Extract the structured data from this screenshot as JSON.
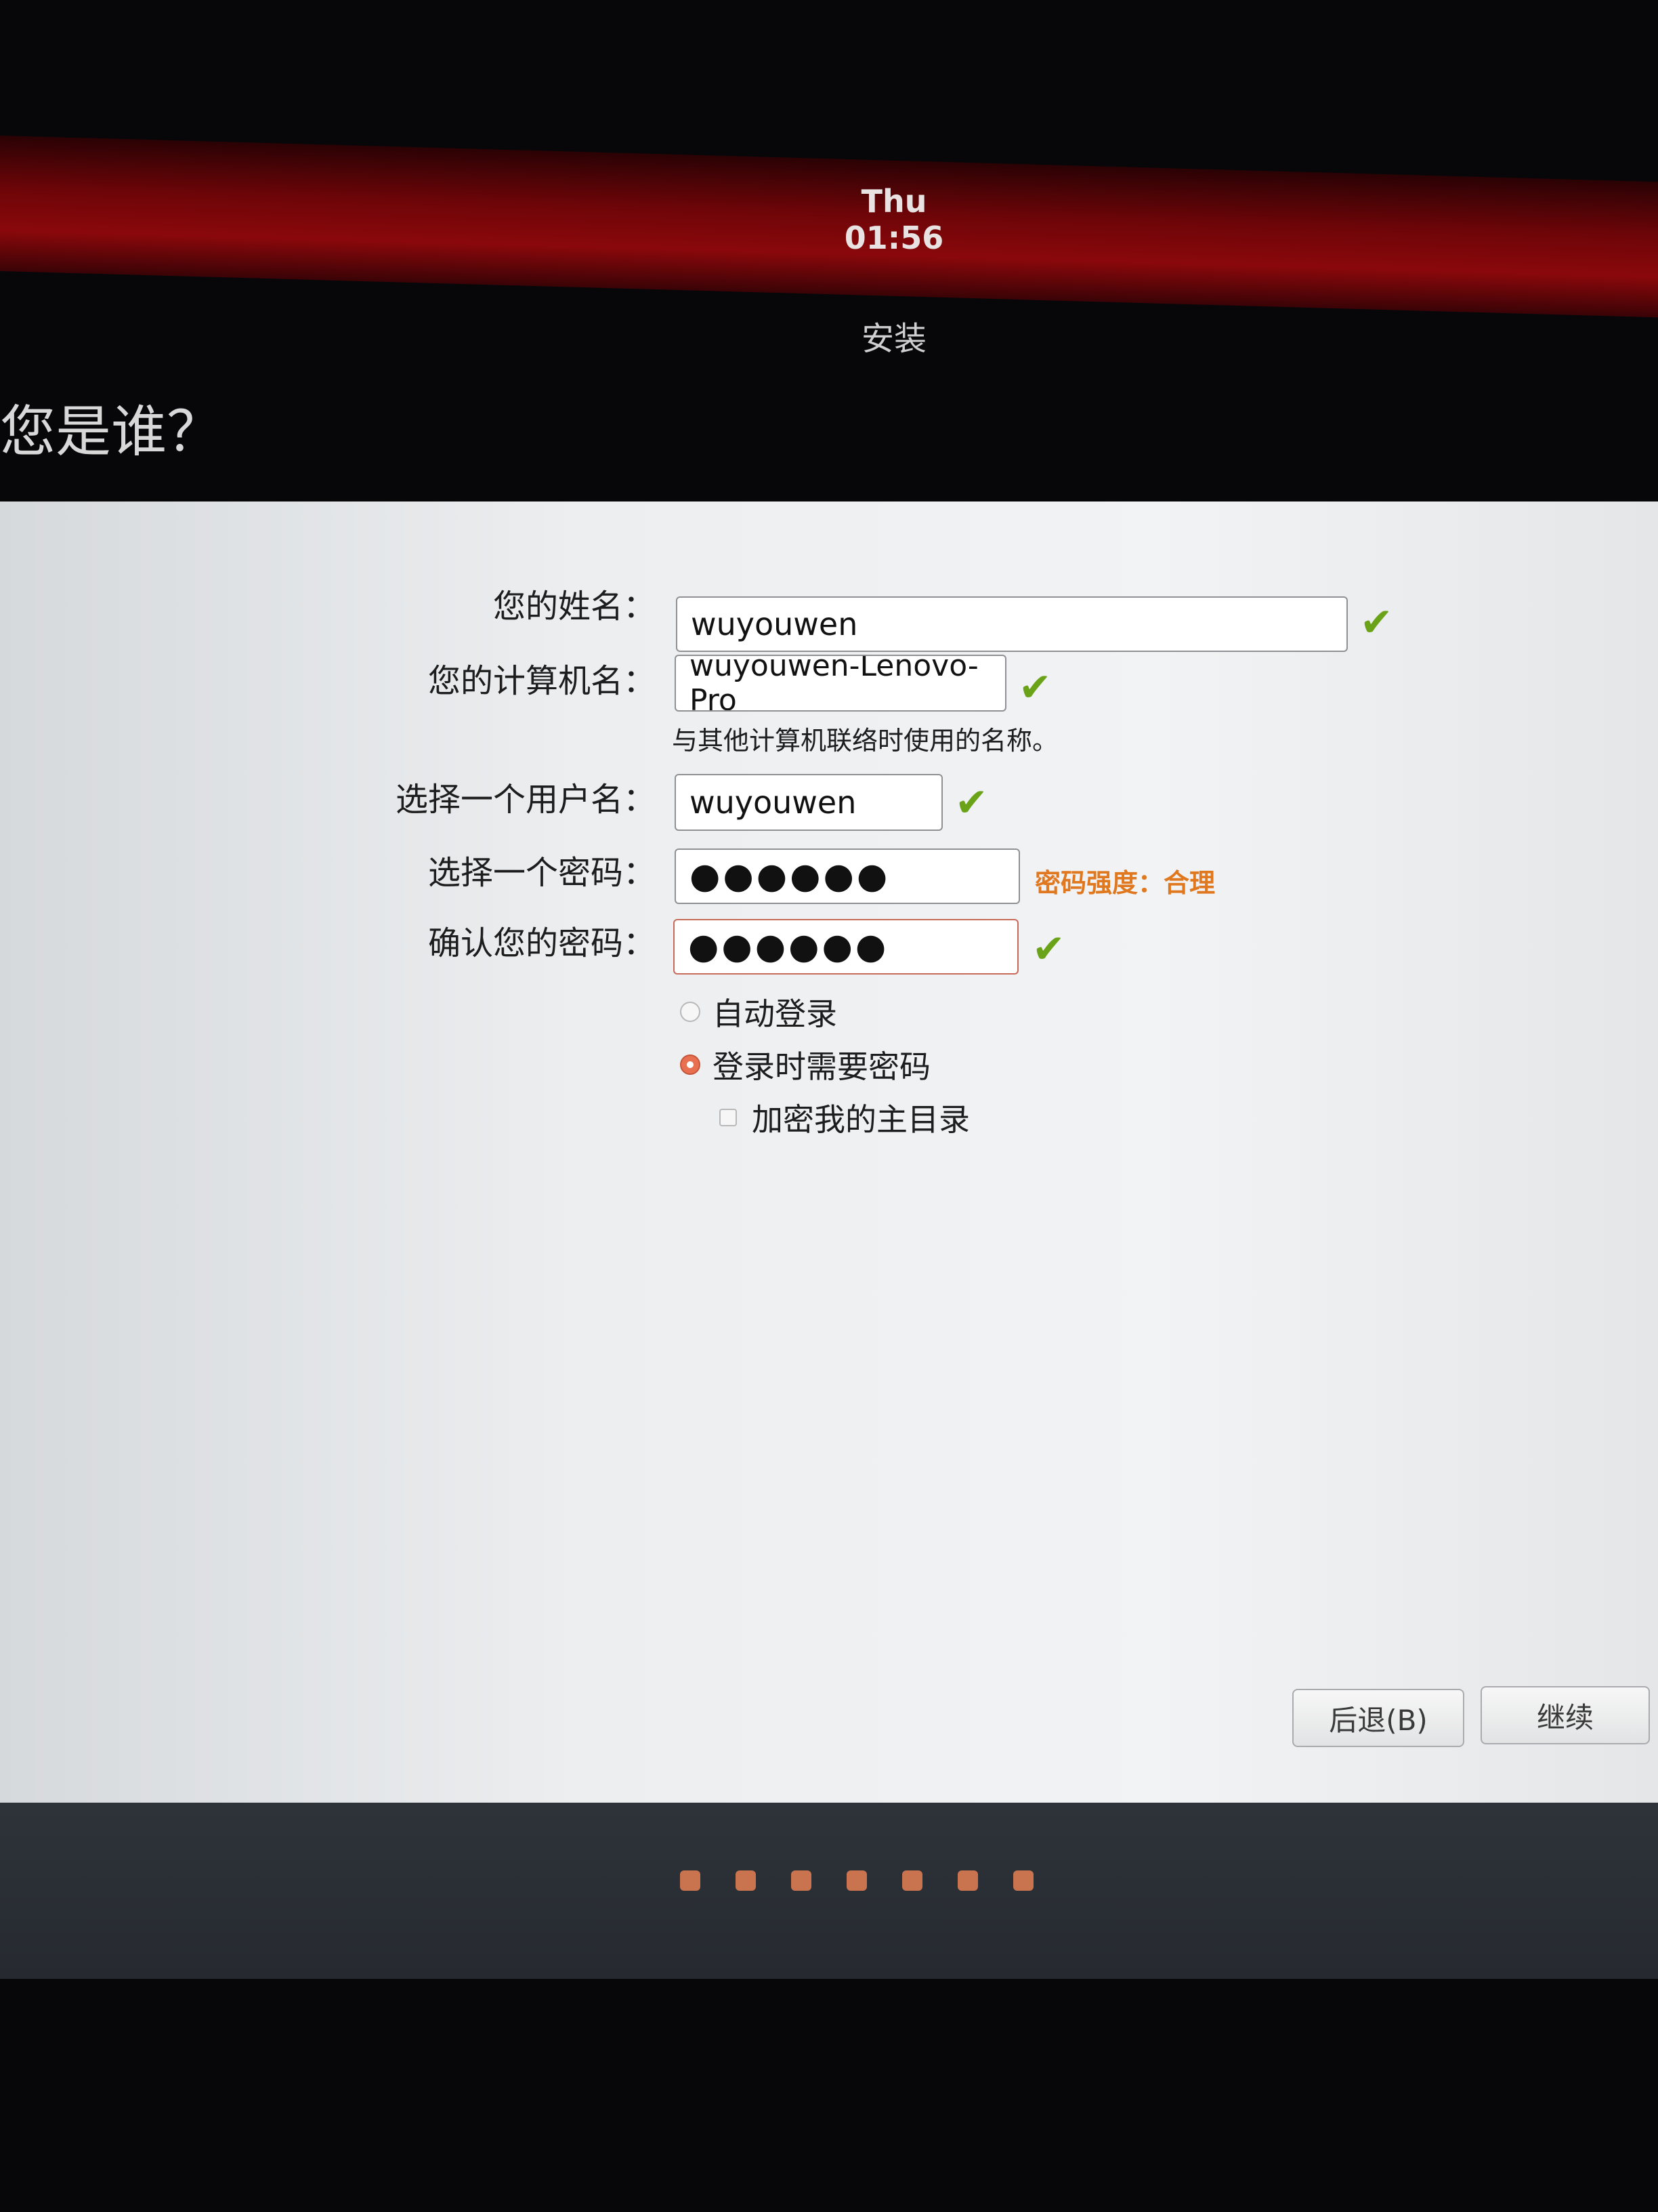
{
  "top_bar": {
    "clock": "Thu 01:56"
  },
  "window": {
    "title": "安装"
  },
  "page": {
    "title": "您是谁？"
  },
  "form": {
    "name": {
      "label": "您的姓名：",
      "value": "wuyouwen"
    },
    "computer_name": {
      "label": "您的计算机名：",
      "value": "wuyouwen-Lenovo-Pro",
      "hint": "与其他计算机联络时使用的名称。"
    },
    "username": {
      "label": "选择一个用户名：",
      "value": "wuyouwen"
    },
    "password": {
      "label": "选择一个密码：",
      "masked": "●●●●●●",
      "strength": "密码强度：合理"
    },
    "confirm_password": {
      "label": "确认您的密码：",
      "masked": "●●●●●●"
    },
    "login_options": {
      "auto_login": "自动登录",
      "require_password": "登录时需要密码",
      "selected": "require_password",
      "encrypt_home": "加密我的主目录",
      "encrypt_home_checked": false
    }
  },
  "buttons": {
    "back": "后退(B)",
    "continue": "继续"
  },
  "progress": {
    "total_steps": 7
  },
  "colors": {
    "accent": "#e07820",
    "check": "#6aa318",
    "step_dot": "#c9744e"
  },
  "icons": {
    "valid": "check-icon"
  }
}
